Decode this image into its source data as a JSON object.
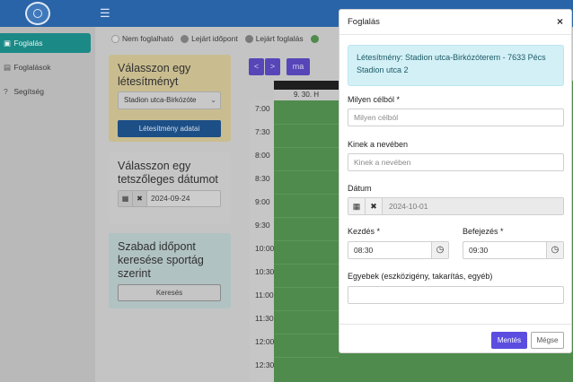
{
  "sidebar": {
    "items": [
      {
        "label": "Foglalás",
        "icon": "calendar-icon"
      },
      {
        "label": "Foglalások",
        "icon": "list-icon"
      },
      {
        "label": "Segítség",
        "icon": "help-icon"
      }
    ]
  },
  "legend": [
    {
      "label": "Nem foglalható",
      "color": "#d5d5d5"
    },
    {
      "label": "Lejárt időpont",
      "color": "#7e7e7e"
    },
    {
      "label": "Lejárt foglalás",
      "color": "#7a7a7a"
    }
  ],
  "facility_card": {
    "title": "Válasszon egy létesítményt",
    "select_value": "Stadion utca-Birkózóte",
    "button": "Létesítmény adatai"
  },
  "date_card": {
    "title": "Válasszon egy tetszőleges dátumot",
    "date_value": "2024-09-24"
  },
  "search_card": {
    "title": "Szabad időpont keresése sportág szerint",
    "button": "Keresés"
  },
  "calendar": {
    "prev": "<",
    "next": ">",
    "today": "ma",
    "day_header": "9. 30. H",
    "times": [
      "7:00",
      "7:30",
      "8:00",
      "8:30",
      "9:00",
      "9:30",
      "10:00",
      "10:30",
      "11:00",
      "11:30",
      "12:00",
      "12:30"
    ],
    "slot_color": "#4f8b4c"
  },
  "modal": {
    "title": "Foglalás",
    "close": "×",
    "facility_label": "Létesítmény",
    "facility_value": ": Stadion utca-Birkózóterem - 7633 Pécs Stadion utca 2",
    "purpose_label": "Milyen célból *",
    "purpose_placeholder": "Milyen célból",
    "name_label": "Kinek a nevében",
    "name_placeholder": "Kinek a nevében",
    "date_label": "Dátum",
    "date_value": "2024-10-01",
    "start_label": "Kezdés *",
    "start_value": "08:30",
    "end_label": "Befejezés *",
    "end_value": "09:30",
    "other_label": "Egyebek (eszközigény, takarítás, egyéb)",
    "save": "Mentés",
    "cancel": "Mégse",
    "accent": "#5b4de0"
  }
}
